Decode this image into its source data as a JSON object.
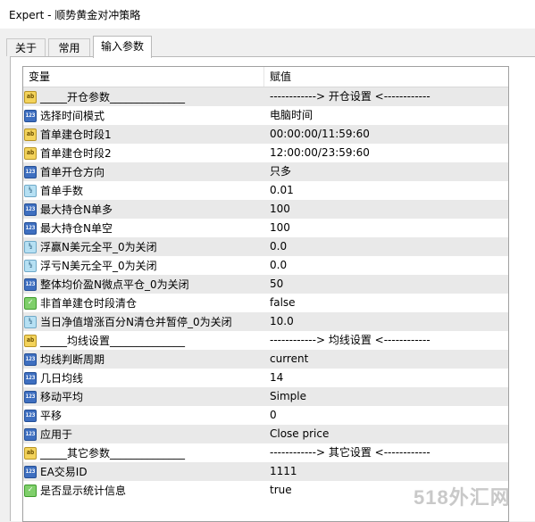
{
  "window": {
    "title": "Expert - 顺势黄金对冲策略"
  },
  "tabs": [
    {
      "label": "关于"
    },
    {
      "label": "常用"
    },
    {
      "label": "输入参数"
    }
  ],
  "table": {
    "headers": {
      "variable": "变量",
      "value": "赋值"
    },
    "rows": [
      {
        "icon": "ab",
        "name": "_____开仓参数______________",
        "value": "------------> 开仓设置 <------------"
      },
      {
        "icon": "n123",
        "name": "选择时间模式",
        "value": "电脑时间"
      },
      {
        "icon": "ab",
        "name": "首单建仓时段1",
        "value": "00:00:00/11:59:60"
      },
      {
        "icon": "ab",
        "name": "首单建仓时段2",
        "value": "12:00:00/23:59:60"
      },
      {
        "icon": "n123",
        "name": "首单开仓方向",
        "value": "只多"
      },
      {
        "icon": "v12",
        "name": "首单手数",
        "value": "0.01"
      },
      {
        "icon": "n123",
        "name": "最大持仓N单多",
        "value": "100"
      },
      {
        "icon": "n123",
        "name": "最大持仓N单空",
        "value": "100"
      },
      {
        "icon": "v12",
        "name": "浮赢N美元全平_0为关闭",
        "value": "0.0"
      },
      {
        "icon": "v12",
        "name": "浮亏N美元全平_0为关闭",
        "value": "0.0"
      },
      {
        "icon": "n123",
        "name": "整体均价盈N微点平仓_0为关闭",
        "value": "50"
      },
      {
        "icon": "bool",
        "name": "非首单建仓时段清仓",
        "value": "false"
      },
      {
        "icon": "v12",
        "name": "当日净值增涨百分N清仓并暂停_0为关闭",
        "value": "10.0"
      },
      {
        "icon": "ab",
        "name": "_____均线设置______________",
        "value": "------------> 均线设置 <------------"
      },
      {
        "icon": "n123",
        "name": "均线判断周期",
        "value": "current"
      },
      {
        "icon": "n123",
        "name": "几日均线",
        "value": "14"
      },
      {
        "icon": "n123",
        "name": "移动平均",
        "value": "Simple"
      },
      {
        "icon": "n123",
        "name": "平移",
        "value": "0"
      },
      {
        "icon": "n123",
        "name": "应用于",
        "value": "Close price"
      },
      {
        "icon": "ab",
        "name": "_____其它参数______________",
        "value": "------------> 其它设置 <------------"
      },
      {
        "icon": "n123",
        "name": "EA交易ID",
        "value": "1111"
      },
      {
        "icon": "bool",
        "name": "是否显示统计信息",
        "value": "true"
      }
    ]
  },
  "icon_labels": {
    "ab": "ab",
    "n123": "123",
    "v12": "½",
    "bool": "✓"
  },
  "watermark": "518外汇网"
}
